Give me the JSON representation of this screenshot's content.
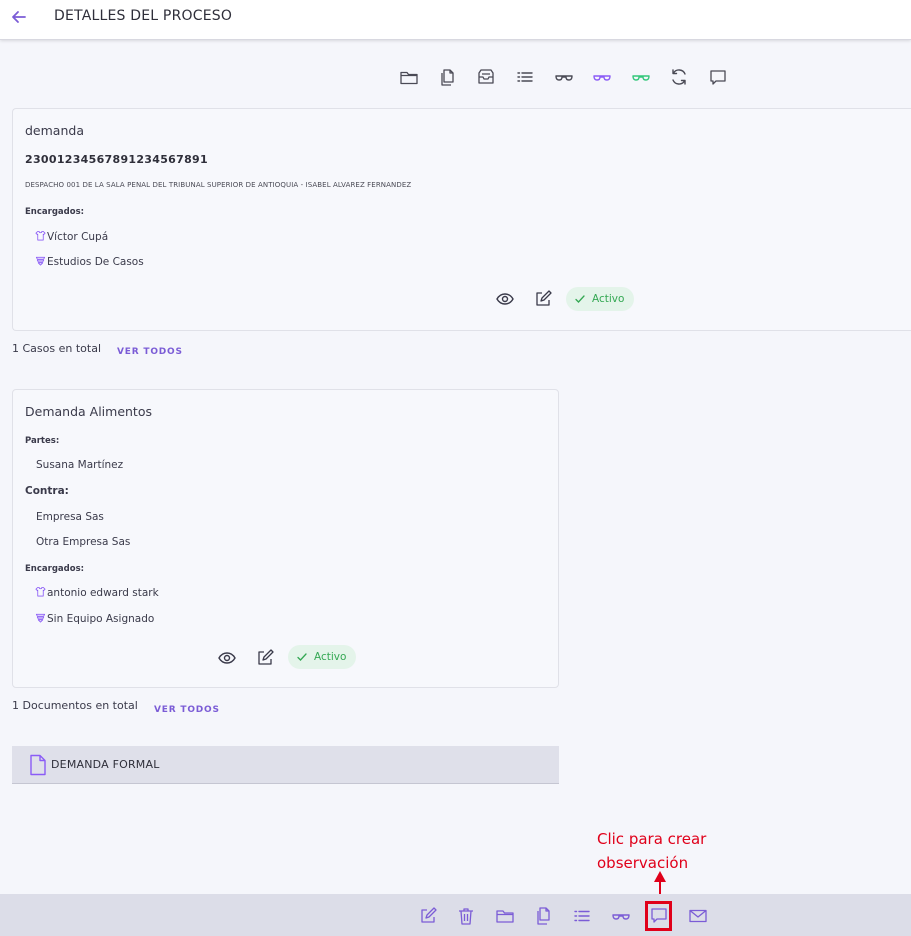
{
  "header": {
    "title": "DETALLES DEL PROCESO"
  },
  "toolbar_top": {
    "icons": [
      "folder-icon",
      "copy-files-icon",
      "inbox-icon",
      "list-icon",
      "glasses-icon",
      "glasses-purple-icon",
      "glasses-green-icon",
      "refresh-icon",
      "comment-icon"
    ],
    "colors": {
      "default": "#4a4a55",
      "purple": "#8b5cf6",
      "green": "#34c77b"
    }
  },
  "process_card": {
    "title": "demanda",
    "radicado": "23001234567891234567891",
    "despacho": "DESPACHO 001 DE LA SALA PENAL DEL TRIBUNAL SUPERIOR DE ANTIOQUIA - ISABEL ALVAREZ FERNANDEZ",
    "encargados_label": "Encargados:",
    "encargados": [
      "Víctor Cupá",
      "Estudios De Casos"
    ],
    "status": "Activo"
  },
  "cases_total": {
    "text": "1 Casos en total",
    "link": "VER TODOS"
  },
  "case_card": {
    "title": "Demanda Alimentos",
    "partes_label": "Partes:",
    "partes": [
      "Susana Martínez"
    ],
    "contra_label": "Contra:",
    "contra": [
      "Empresa Sas",
      "Otra Empresa Sas"
    ],
    "encargados_label": "Encargados:",
    "encargados": [
      "antonio edward stark",
      "Sin Equipo Asignado"
    ],
    "status": "Activo"
  },
  "documents_total": {
    "text": "1 Documentos en total",
    "link": "VER TODOS"
  },
  "documents": [
    {
      "name": "DEMANDA FORMAL"
    }
  ],
  "annotation": {
    "line1": "Clic para crear",
    "line2": "observación",
    "color": "#e0001a"
  },
  "bottom_bar": {
    "icons": [
      "edit-icon",
      "trash-icon",
      "folder-icon",
      "copy-files-icon",
      "list-icon",
      "glasses-icon",
      "comment-icon",
      "mail-icon"
    ],
    "accent": "#7b5cd6"
  }
}
